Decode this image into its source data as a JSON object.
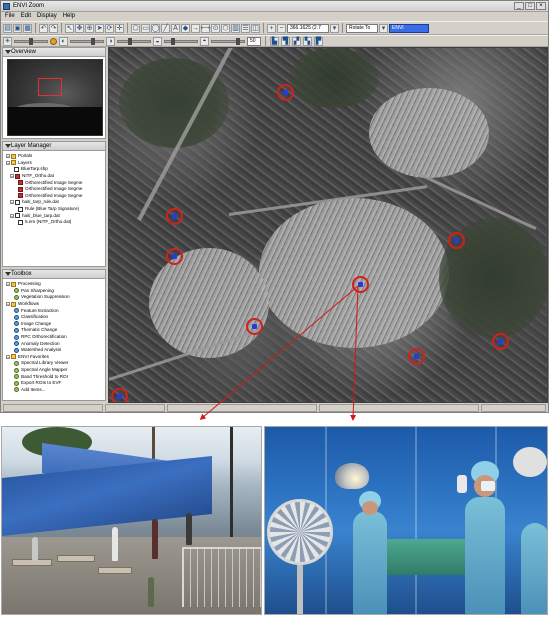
{
  "window": {
    "title": "ENVI Zoom",
    "min_glyph": "_",
    "max_glyph": "□",
    "close_glyph": "×"
  },
  "menubar": {
    "items": [
      "File",
      "Edit",
      "Display",
      "Help"
    ]
  },
  "toolbar": {
    "zoom_value": "366.1625 (2.7",
    "rotate_label": "Rotate To",
    "layer_select": "ENVI",
    "contrast_value": "50",
    "icons": [
      "open-icon",
      "save-icon",
      "print-icon",
      "undo-icon",
      "redo-icon",
      "select-icon",
      "pan-icon",
      "zoom-icon",
      "fly-icon",
      "rotate-icon",
      "crosshair-icon",
      "vector-icon",
      "annotation-icon",
      "measure-icon"
    ]
  },
  "panels": {
    "overview": {
      "title": "Overview"
    },
    "layer_manager": {
      "title": "Layer Manager",
      "items": [
        "Portals",
        "Layers",
        "BlueTarp.shp",
        "NITF_Ortho.dat",
        "Orthorectified Image Segme",
        "Orthorectified Image Segme",
        "Orthorectified Image Segme",
        "haiti_tarp_rule.dat",
        "Rule (Blue Tarp Signature)",
        "haiti_blue_tarp.dat",
        "5.em (NITF_Ortho.dat)"
      ]
    },
    "toolbox": {
      "title": "Toolbox",
      "items": [
        "Processing",
        "Pan Sharpening",
        "Vegetation Suppression",
        "Workflows",
        "Feature Extraction",
        "Classification",
        "Image Change",
        "Thematic Change",
        "RPC Orthorectification",
        "Anomaly Detection",
        "Watershed Analysis",
        "ENVI Favorites",
        "Spectral Library Viewer",
        "Spectral Angle Mapper",
        "Band Threshold to ROI",
        "Export ROIs to EVF",
        "Add Items..."
      ]
    }
  },
  "status": {
    "cells": [
      "",
      "",
      "",
      "",
      ""
    ]
  },
  "colors": {
    "marker": "#d02020",
    "tarp": "#2a3ad8",
    "chrome": "#d4d0c8",
    "callout": "#d01818"
  }
}
